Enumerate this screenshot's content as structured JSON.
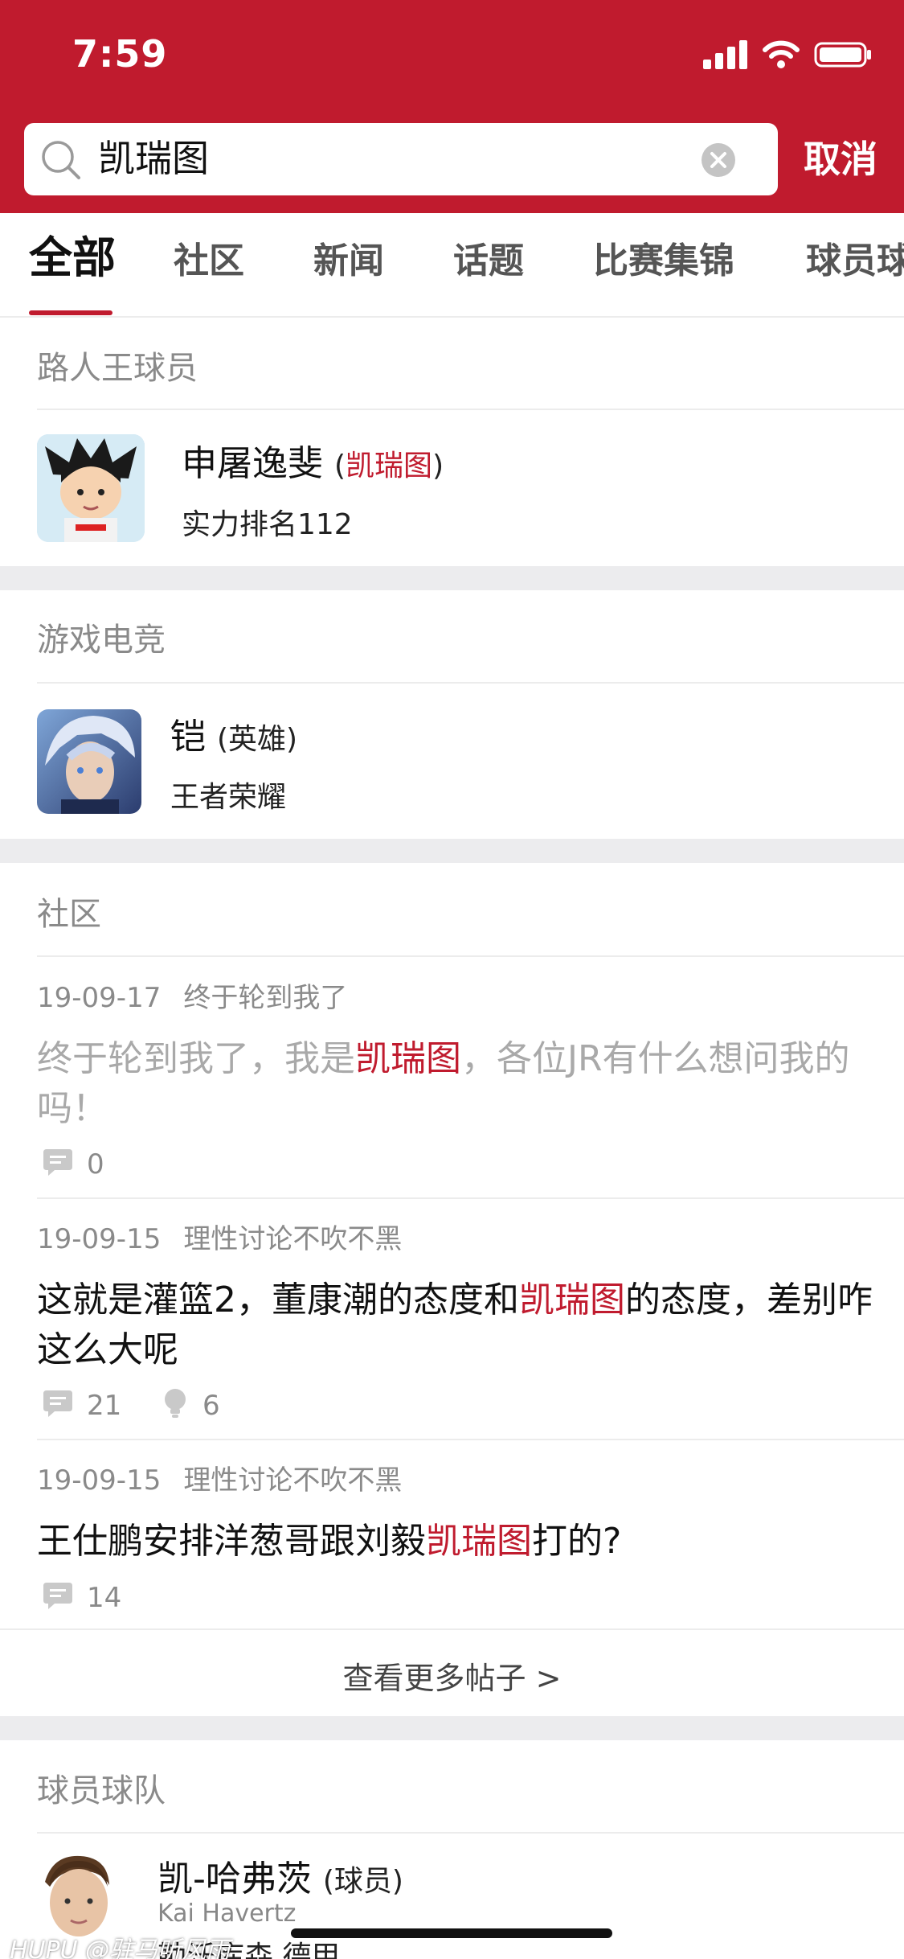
{
  "status_bar": {
    "time": "7:59"
  },
  "search": {
    "query": "凯瑞图",
    "cancel_label": "取消"
  },
  "colors": {
    "brand_red": "#c01b2e",
    "section_gray": "#ececee"
  },
  "tabs": [
    {
      "label": "全部",
      "active": true
    },
    {
      "label": "社区"
    },
    {
      "label": "新闻"
    },
    {
      "label": "话题"
    },
    {
      "label": "比赛集锦"
    },
    {
      "label": "球员球"
    }
  ],
  "sections": {
    "player_king": {
      "title": "路人王球员",
      "item": {
        "name": "申屠逸斐",
        "paren_left": "(",
        "alias": "凯瑞图",
        "paren_right": ")",
        "sub": "实力排名112"
      }
    },
    "esports": {
      "title": "游戏电竞",
      "item": {
        "name": "铠",
        "tag": "(英雄)",
        "sub": "王者荣耀"
      }
    },
    "community": {
      "title": "社区",
      "posts": [
        {
          "date": "19-09-17",
          "forum": "终于轮到我了",
          "title_pre": "终于轮到我了，我是",
          "title_hl": "凯瑞图",
          "title_post": "，各位JR有什么想问我的吗！",
          "comments": "0"
        },
        {
          "date": "19-09-15",
          "forum": "理性讨论不吹不黑",
          "title_pre": "这就是灌篮2，董康潮的态度和",
          "title_hl": "凯瑞图",
          "title_post": "的态度，差别咋这么大呢",
          "comments": "21",
          "lights": "6"
        },
        {
          "date": "19-09-15",
          "forum": "理性讨论不吹不黑",
          "title_pre": "王仕鹏安排洋葱哥跟刘毅",
          "title_hl": "凯瑞图",
          "title_post": "打的?",
          "comments": "14"
        }
      ],
      "more_label": "查看更多帖子 >"
    },
    "players_teams": {
      "title": "球员球队",
      "item": {
        "name": "凯-哈弗茨",
        "tag": "(球员)",
        "en_name": "Kai Havertz",
        "sub": "勒沃库森 德甲"
      }
    }
  },
  "watermark": "HUPU @驻马听风雨"
}
